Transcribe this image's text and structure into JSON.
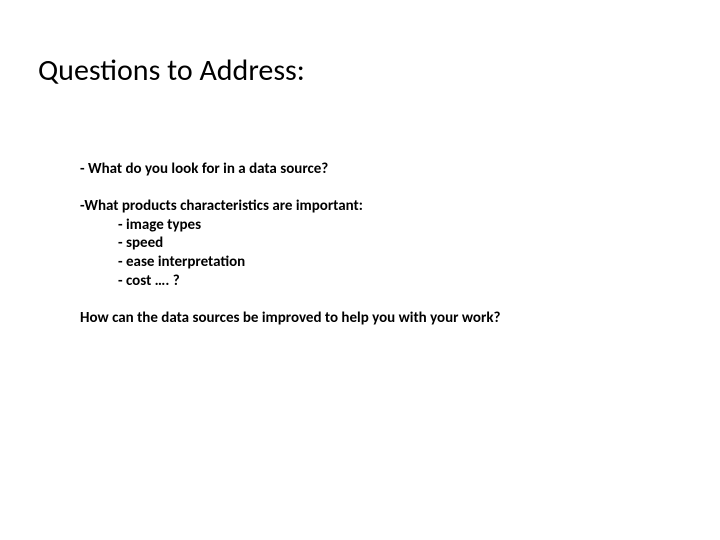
{
  "title": "Questions to Address:",
  "q1": "- What do you look for in a data source?",
  "q2_lead": "-What products characteristics are important:",
  "q2_sub": [
    "- image types",
    "- speed",
    "- ease interpretation",
    "- cost …. ?"
  ],
  "q3": "How can the data sources be improved to help you with your work?"
}
